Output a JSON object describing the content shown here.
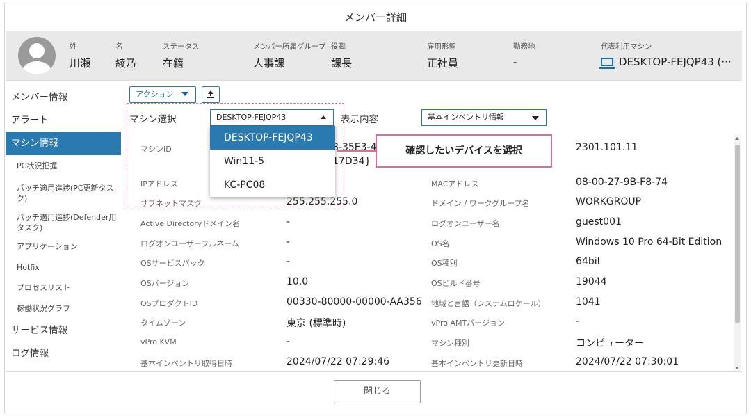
{
  "title": "メンバー詳細",
  "member": {
    "fields": [
      {
        "label": "姓",
        "value": "川瀬"
      },
      {
        "label": "名",
        "value": "綾乃"
      },
      {
        "label": "ステータス",
        "value": "在籍"
      },
      {
        "label": "メンバー所属グループ",
        "value": "人事課"
      },
      {
        "label": "役職",
        "value": "課長"
      },
      {
        "label": "雇用形態",
        "value": "正社員"
      },
      {
        "label": "勤務地",
        "value": "-"
      }
    ],
    "machine_label": "代表利用マシン",
    "machine_value": "DESKTOP-FEJQP43 (···"
  },
  "sidebar": {
    "items": [
      {
        "label": "メンバー情報"
      },
      {
        "label": "アラート"
      },
      {
        "label": "マシン情報"
      },
      {
        "label": "PC状況把握"
      },
      {
        "label": "パッチ適用進捗(PC更新タスク)"
      },
      {
        "label": "パッチ適用進捗(Defender用タスク)"
      },
      {
        "label": "アプリケーション"
      },
      {
        "label": "Hotfix"
      },
      {
        "label": "プロセスリスト"
      },
      {
        "label": "稼働状況グラフ"
      },
      {
        "label": "サービス情報"
      },
      {
        "label": "ログ情報"
      }
    ]
  },
  "toolbar": {
    "action_label": "アクション"
  },
  "machine_select": {
    "label": "マシン選択",
    "value": "DESKTOP-FEJQP43",
    "options": [
      "DESKTOP-FEJQP43",
      "Win11-5",
      "KC-PC08"
    ]
  },
  "display": {
    "label": "表示内容",
    "value": "基本インベントリ情報"
  },
  "callout": "確認したいデバイスを選択",
  "details": {
    "left": [
      {
        "key": "マシンID",
        "value": "8-35E3-4"
      },
      {
        "key": "",
        "value": "17D34}"
      },
      {
        "key": "IPアドレス",
        "value": ""
      },
      {
        "key": "サブネットマスク",
        "value": "255.255.255.0"
      },
      {
        "key": "Active Directoryドメイン名",
        "value": "-"
      },
      {
        "key": "ログオンユーザーフルネーム",
        "value": "-"
      },
      {
        "key": "OSサービスパック",
        "value": "-"
      },
      {
        "key": "OSバージョン",
        "value": "10.0"
      },
      {
        "key": "OSプロダクトID",
        "value": "00330-80000-00000-AA356"
      },
      {
        "key": "タイムゾーン",
        "value": "東京 (標準時)"
      },
      {
        "key": "vPro KVM",
        "value": "-"
      },
      {
        "key": "基本インベントリ取得日時",
        "value": "2024/07/22 07:29:46"
      }
    ],
    "right": [
      {
        "key": "",
        "value": "2301.101.11"
      },
      {
        "key": "MACアドレス",
        "value": "08-00-27-9B-F8-74"
      },
      {
        "key": "ドメイン / ワークグループ名",
        "value": "WORKGROUP"
      },
      {
        "key": "ログオンユーザー名",
        "value": "guest001"
      },
      {
        "key": "OS名",
        "value": "Windows 10 Pro 64-Bit Edition"
      },
      {
        "key": "OS種別",
        "value": "64bit"
      },
      {
        "key": "OSビルド番号",
        "value": "19044"
      },
      {
        "key": "地域と言語（システムロケール）",
        "value": "1041"
      },
      {
        "key": "vPro AMTバージョン",
        "value": "-"
      },
      {
        "key": "マシン種別",
        "value": "コンピューター"
      },
      {
        "key": "基本インベントリ更新日時",
        "value": "2024/07/22 07:30:01"
      }
    ]
  },
  "close_label": "閉じる"
}
